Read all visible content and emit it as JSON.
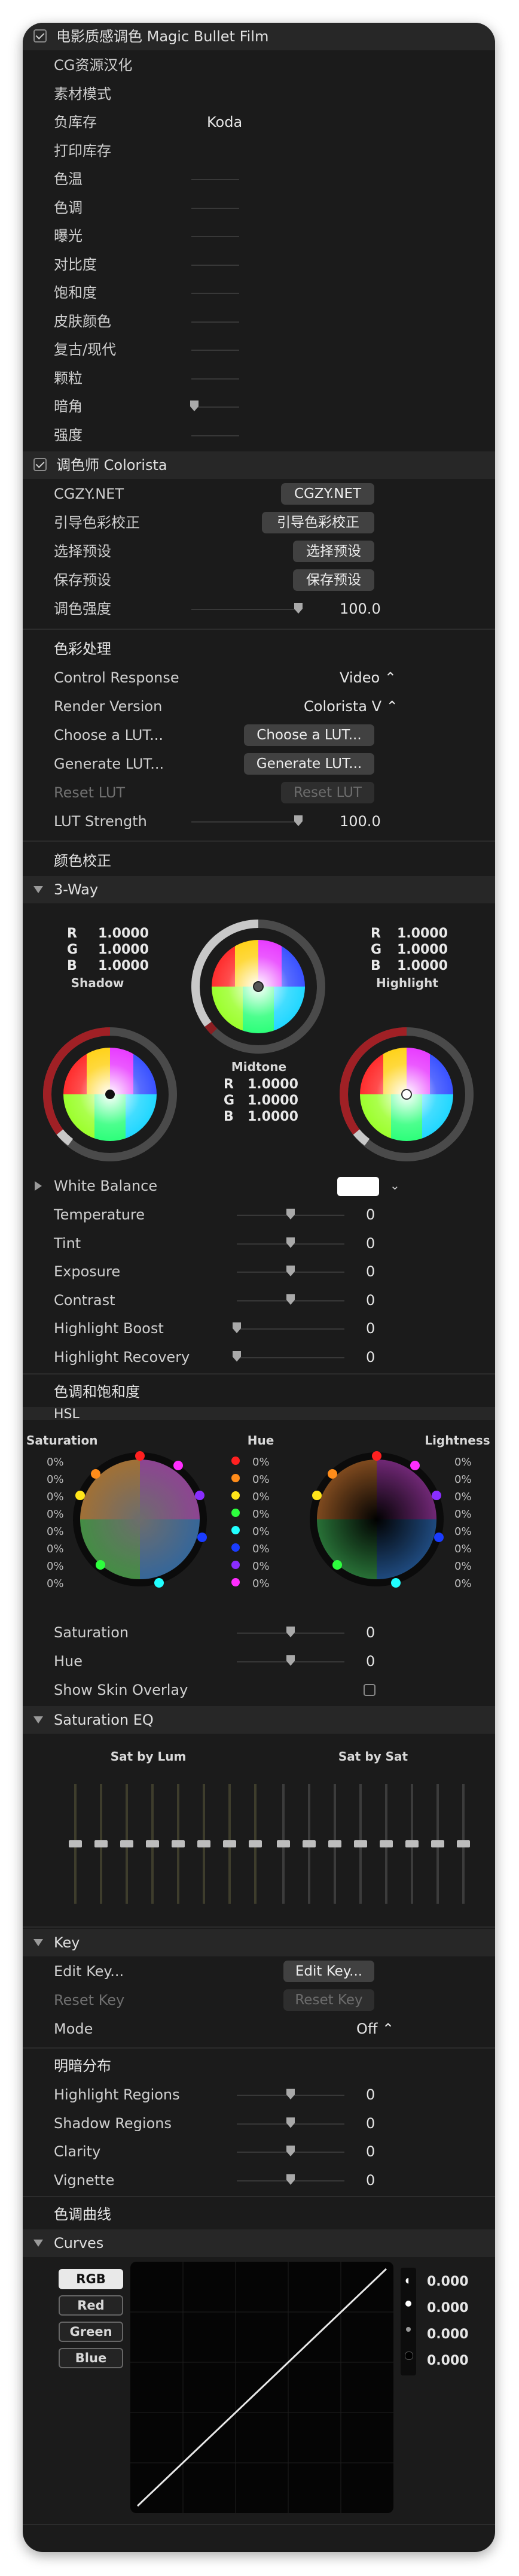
{
  "mbf": {
    "title": "电影质感调色 Magic Bullet Film",
    "rows": [
      {
        "label": "CG资源汉化",
        "value": ""
      },
      {
        "label": "素材模式",
        "value": ""
      },
      {
        "label": "负库存",
        "value": "Koda"
      },
      {
        "label": "打印库存",
        "value": ""
      },
      {
        "label": "色温",
        "value": ""
      },
      {
        "label": "色调",
        "value": ""
      },
      {
        "label": "曝光",
        "value": ""
      },
      {
        "label": "对比度",
        "value": ""
      },
      {
        "label": "饱和度",
        "value": ""
      },
      {
        "label": "皮肤颜色",
        "value": ""
      },
      {
        "label": "复古/现代",
        "value": ""
      },
      {
        "label": "颗粒",
        "value": ""
      },
      {
        "label": "暗角",
        "value": ""
      },
      {
        "label": "强度",
        "value": ""
      }
    ]
  },
  "colorista": {
    "title": "调色师 Colorista",
    "cgzy_label": "CGZY.NET",
    "cgzy_btn": "CGZY.NET",
    "guide_label": "引导色彩校正",
    "guide_btn": "引导色彩校正",
    "preset_select_label": "选择预设",
    "preset_select_btn": "选择预设",
    "preset_save_label": "保存预设",
    "preset_save_btn": "保存预设",
    "strength_label": "调色强度",
    "strength_value": "100.0"
  },
  "color_processing": {
    "title": "色彩处理",
    "control_response_label": "Control Response",
    "control_response_value": "Video ⌃",
    "render_version_label": "Render Version",
    "render_version_value": "Colorista V ⌃",
    "choose_lut_label": "Choose a LUT...",
    "choose_lut_btn": "Choose a LUT...",
    "generate_lut_label": "Generate LUT...",
    "generate_lut_btn": "Generate LUT...",
    "reset_lut_label": "Reset LUT",
    "reset_lut_btn": "Reset LUT",
    "lut_strength_label": "LUT Strength",
    "lut_strength_value": "100.0"
  },
  "color_correction": {
    "title": "颜色校正",
    "three_way": "3-Way",
    "shadow": {
      "name": "Shadow",
      "r": "1.0000",
      "g": "1.0000",
      "b": "1.0000"
    },
    "midtone": {
      "name": "Midtone",
      "r": "1.0000",
      "g": "1.0000",
      "b": "1.0000"
    },
    "highlight": {
      "name": "Highlight",
      "r": "1.0000",
      "g": "1.0000",
      "b": "1.0000"
    },
    "rgb_letters": "R\nG\nB",
    "white_balance": "White Balance",
    "params": [
      {
        "label": "Temperature",
        "value": "0",
        "level": 0.5
      },
      {
        "label": "Tint",
        "value": "0",
        "level": 0.5
      },
      {
        "label": "Exposure",
        "value": "0",
        "level": 0.5
      },
      {
        "label": "Contrast",
        "value": "0",
        "level": 0.5
      },
      {
        "label": "Highlight Boost",
        "value": "0",
        "level": 0.0
      },
      {
        "label": "Highlight Recovery",
        "value": "0",
        "level": 0.0
      }
    ]
  },
  "hue_sat": {
    "title": "色调和饱和度",
    "hsl": "HSL",
    "saturation_caption": "Saturation",
    "hue_caption": "Hue",
    "lightness_caption": "Lightness",
    "pct_column": "0%\n0%\n0%\n0%\n0%\n0%\n0%\n0%",
    "params": [
      {
        "label": "Saturation",
        "value": "0",
        "level": 0.5
      },
      {
        "label": "Hue",
        "value": "0",
        "level": 0.5
      }
    ],
    "skin_overlay": "Show Skin Overlay"
  },
  "sat_eq": {
    "title": "Saturation EQ",
    "lum_caption": "Sat by Lum",
    "sat_caption": "Sat by Sat"
  },
  "key": {
    "title": "Key",
    "edit_label": "Edit Key...",
    "edit_btn": "Edit Key...",
    "reset_label": "Reset Key",
    "reset_btn": "Reset Key",
    "mode_label": "Mode",
    "mode_value": "Off ⌃"
  },
  "tone": {
    "title": "明暗分布",
    "params": [
      {
        "label": "Highlight Regions",
        "value": "0",
        "level": 0.5
      },
      {
        "label": "Shadow Regions",
        "value": "0",
        "level": 0.5
      },
      {
        "label": "Clarity",
        "value": "0",
        "level": 0.5
      },
      {
        "label": "Vignette",
        "value": "0",
        "level": 0.5
      }
    ]
  },
  "curves": {
    "title": "色调曲线",
    "section": "Curves",
    "channels": [
      "RGB",
      "Red",
      "Green",
      "Blue"
    ],
    "readouts": [
      "0.000",
      "0.000",
      "0.000",
      "0.000"
    ]
  },
  "colors": {
    "panel": "#1b1b1b",
    "section": "#272727",
    "button": "#414141"
  }
}
